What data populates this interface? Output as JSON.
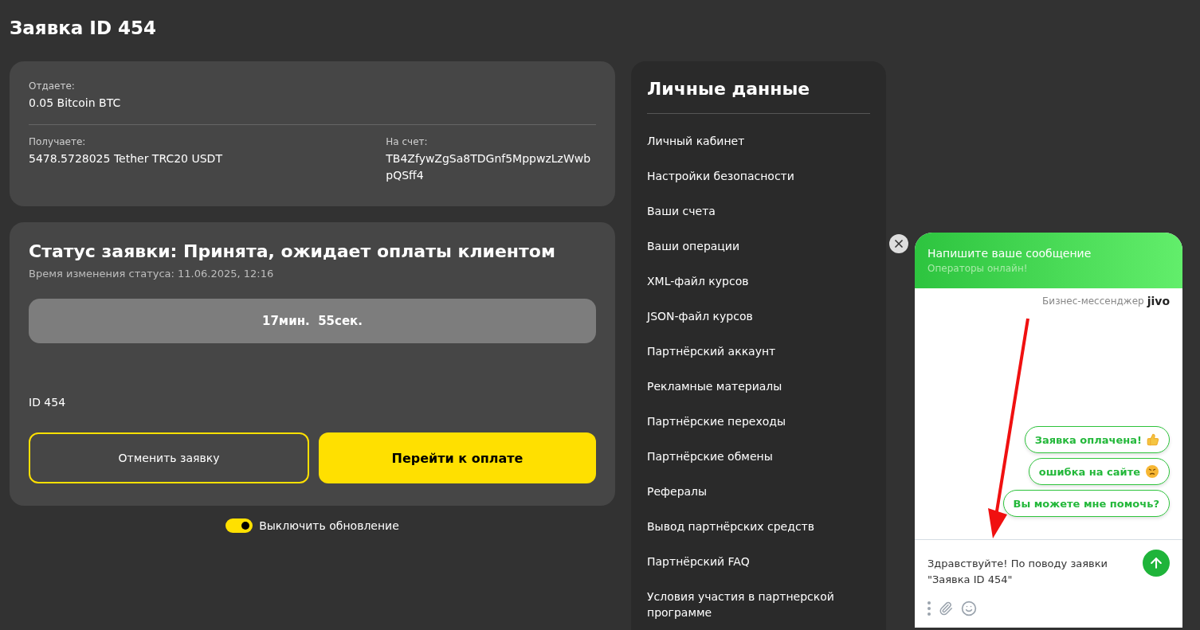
{
  "page_title": "Заявка ID 454",
  "summary": {
    "give_label": "Отдаете:",
    "give_value": "0.05 Bitcoin BTC",
    "get_label": "Получаете:",
    "get_value": "5478.5728025 Tether TRC20 USDT",
    "account_label": "На счет:",
    "account_value": "TB4ZfywZgSa8TDGnf5MppwzLzWwbpQSff4"
  },
  "status": {
    "title": "Статус заявки: Принята, ожидает оплаты клиентом",
    "changed": "Время изменения статуса: 11.06.2025, 12:16",
    "timer": "17мин.  55сек.",
    "order_id": "ID 454"
  },
  "buttons": [
    {
      "label": "Отменить заявку",
      "kind": "outline"
    },
    {
      "label": "Перейти к оплате",
      "kind": "primary"
    }
  ],
  "auto_refresh": {
    "label": "Выключить обновление",
    "on": true
  },
  "sidebar": {
    "title": "Личные данные",
    "items": [
      "Личный кабинет",
      "Настройки безопасности",
      "Ваши счета",
      "Ваши операции",
      "XML-файл курсов",
      "JSON-файл курсов",
      "Партнёрский аккаунт",
      "Рекламные материалы",
      "Партнёрские переходы",
      "Партнёрские обмены",
      "Рефералы",
      "Вывод партнёрских средств",
      "Партнёрский FAQ",
      "Условия участия в партнерской программе"
    ]
  },
  "chat": {
    "title": "Напишите ваше сообщение",
    "subtitle": "Операторы онлайн!",
    "brand_caption": "Бизнес-мессенджер",
    "brand_logo": "jivo",
    "quick_replies": [
      {
        "label": "Заявка оплачена!",
        "kind": "thumbs"
      },
      {
        "label": "ошибка на сайте",
        "kind": "angry"
      },
      {
        "label": "Вы можете мне помочь?",
        "kind": "plain"
      }
    ],
    "message": "Здравствуйте! По поводу заявки \"Заявка ID 454\""
  }
}
